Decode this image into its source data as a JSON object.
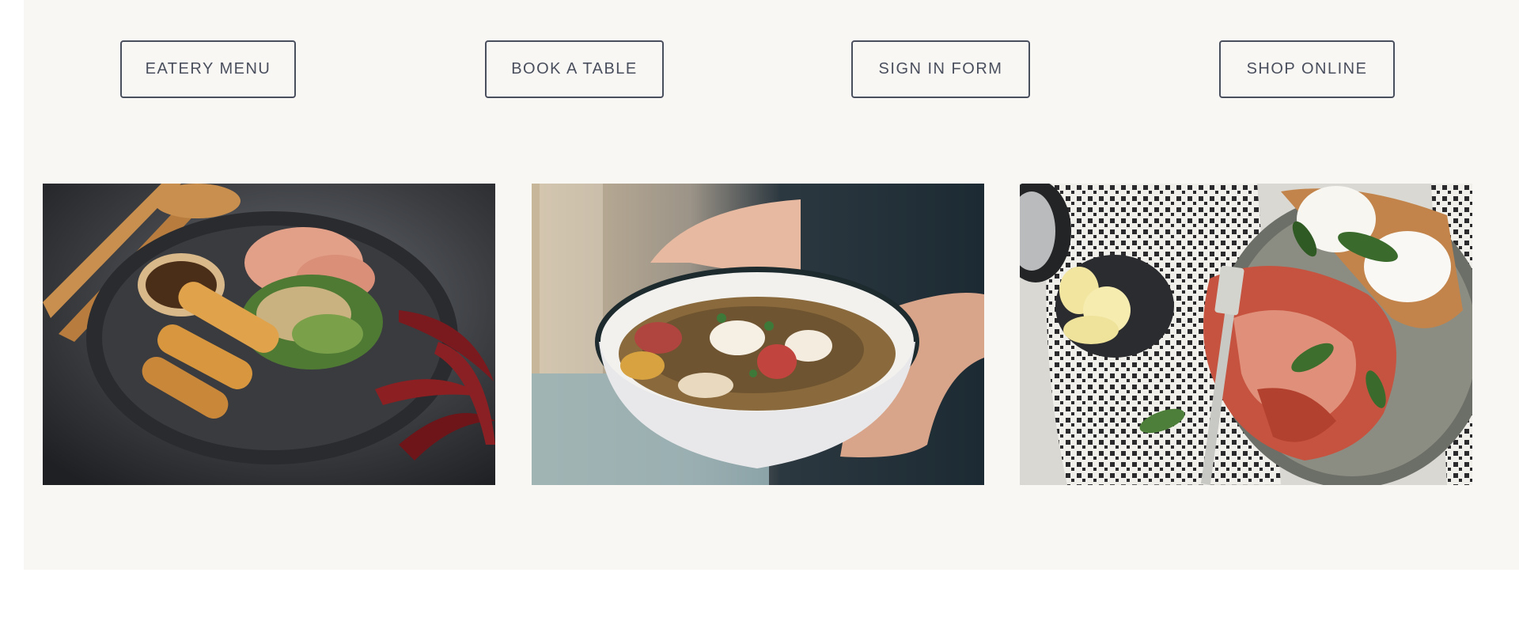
{
  "nav_buttons": {
    "menu": "EATERY MENU",
    "book": "BOOK A TABLE",
    "signin": "SIGN IN FORM",
    "shop": "SHOP ONLINE"
  },
  "colors": {
    "panel_bg": "#f9f7f4",
    "button_border": "#4a4f5e",
    "button_text": "#4a4f5e"
  },
  "images": [
    {
      "name": "spring-rolls-salad-photo"
    },
    {
      "name": "granola-bowl-photo"
    },
    {
      "name": "bacon-eggs-breakfast-photo"
    }
  ]
}
